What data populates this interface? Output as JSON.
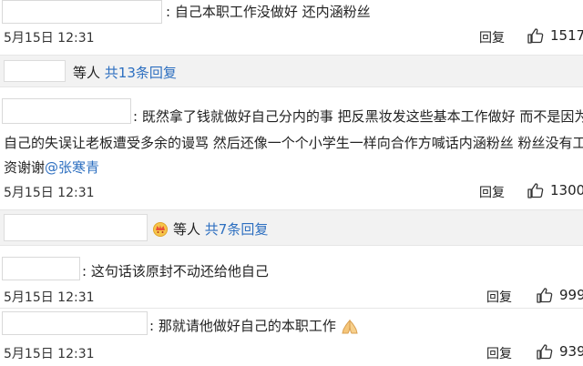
{
  "comments": [
    {
      "separator": ":",
      "text": "自己本职工作没做好 还内涵粉丝",
      "time": "5月15日 12:31",
      "reply_label": "回复",
      "likes": "1517"
    },
    {
      "separator": ":",
      "text_line1": "既然拿了钱就做好自己分内的事 把反黑妆发这些基本工作做好 而不是因为",
      "text_line2": "自己的失误让老板遭受多余的谩骂 然后还像一个个小学生一样向合作方喊话内涵粉丝 粉丝没有工",
      "text_line3_prefix": "资谢谢",
      "mention": "@张寒青",
      "time": "5月15日 12:31",
      "reply_label": "回复",
      "likes": "1300"
    },
    {
      "separator": ":",
      "text": "这句话该原封不动还给他自己",
      "time": "5月15日 12:31",
      "reply_label": "回复",
      "likes": "999"
    },
    {
      "separator": ":",
      "text": "那就请他做好自己的本职工作",
      "time": "5月15日 12:31",
      "reply_label": "回复",
      "likes": "939"
    }
  ],
  "reply_bars": [
    {
      "prefix": "等人",
      "link": "共13条回复"
    },
    {
      "prefix": "等人",
      "link": "共7条回复"
    }
  ],
  "icons": {
    "like": "thumbs-up-icon",
    "hands": "pray-hands-emoji",
    "badge": "crown-badge-icon"
  },
  "colors": {
    "link": "#2d6fc0",
    "bar_bg": "#f2f2f2"
  }
}
